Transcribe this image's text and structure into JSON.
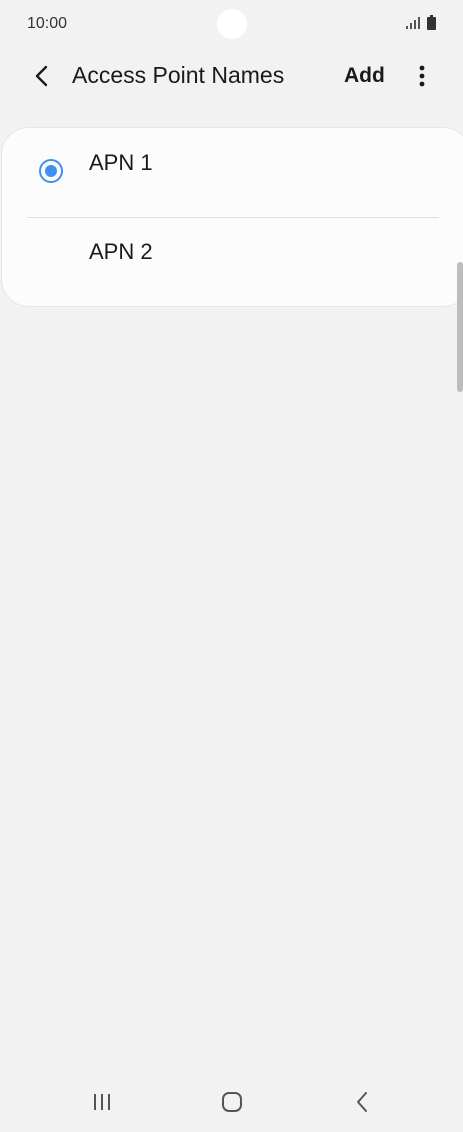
{
  "status_bar": {
    "time": "10:00",
    "icons": [
      "signal-icon",
      "battery-icon"
    ]
  },
  "app_bar": {
    "back_icon": "chevron-left-icon",
    "title": "Access Point Names",
    "add_label": "Add",
    "more_icon": "more-vertical-icon"
  },
  "apn_list": {
    "items": [
      {
        "label": "APN 1",
        "selected": true
      },
      {
        "label": "APN 2",
        "selected": false
      }
    ]
  },
  "nav_bar": {
    "icons": [
      "recents-icon",
      "home-icon",
      "back-icon"
    ]
  },
  "colors": {
    "accent": "#3e91f2",
    "background": "#f2f2f2",
    "card": "#fcfcfc"
  }
}
